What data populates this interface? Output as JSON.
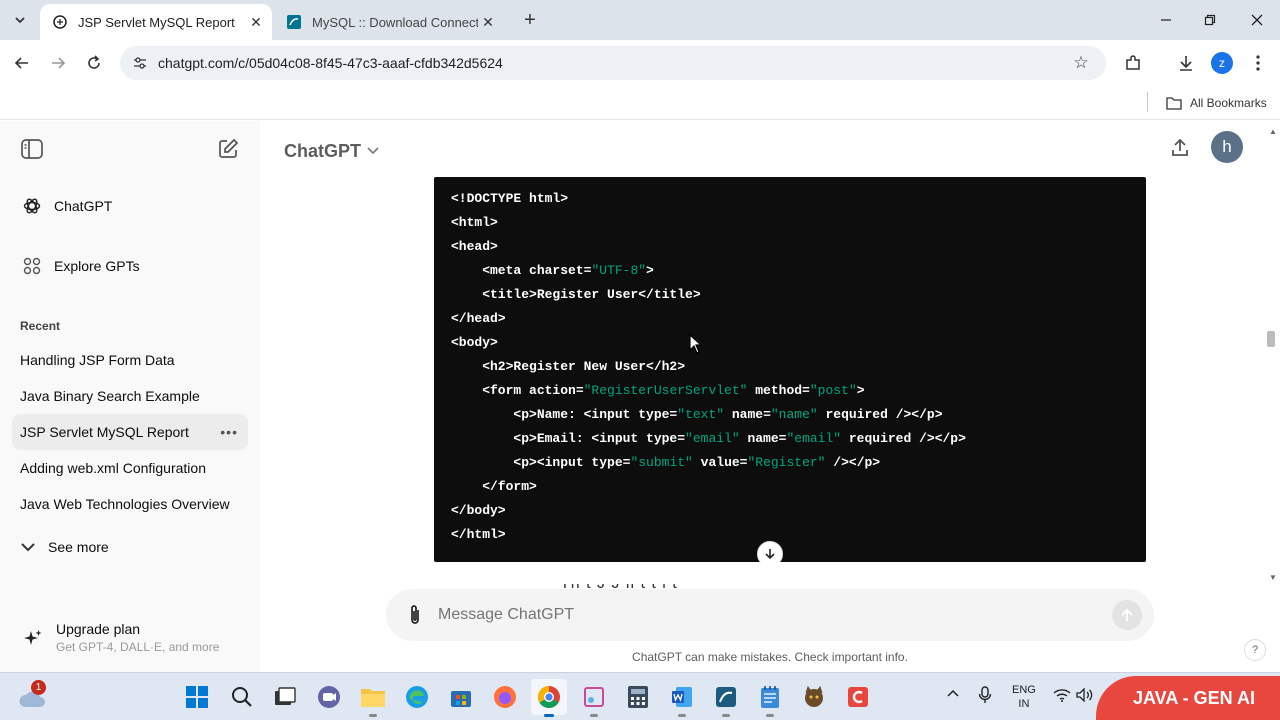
{
  "browser": {
    "tabs": [
      {
        "title": "JSP Servlet MySQL Report",
        "active": true
      },
      {
        "title": "MySQL :: Download Connector/J",
        "active": false
      }
    ],
    "url": "chatgpt.com/c/05d04c08-8f45-47c3-aaaf-cfdb342d5624",
    "profile_initial": "z",
    "bookmarks_label": "All Bookmarks"
  },
  "sidebar": {
    "nav": [
      {
        "label": "ChatGPT",
        "icon": "chatgpt-logo-icon"
      },
      {
        "label": "Explore GPTs",
        "icon": "grid-icon"
      }
    ],
    "recent_label": "Recent",
    "chats": [
      {
        "label": "Handling JSP Form Data",
        "active": false
      },
      {
        "label": "Java Binary Search Example",
        "active": false
      },
      {
        "label": "JSP Servlet MySQL Report",
        "active": true
      },
      {
        "label": "Adding web.xml Configuration",
        "active": false
      },
      {
        "label": "Java Web Technologies Overview",
        "active": false
      }
    ],
    "see_more": "See more",
    "upgrade": {
      "title": "Upgrade plan",
      "subtitle": "Get GPT-4, DALL·E, and more"
    }
  },
  "main": {
    "model": "ChatGPT",
    "user_initial": "h",
    "code_lines": [
      [
        {
          "t": "<!DOCTYPE html>",
          "s": false
        }
      ],
      [
        {
          "t": "<html>",
          "s": false
        }
      ],
      [
        {
          "t": "<head>",
          "s": false
        }
      ],
      [
        {
          "t": "    <meta charset=",
          "s": false
        },
        {
          "t": "\"UTF-8\"",
          "s": true
        },
        {
          "t": ">",
          "s": false
        }
      ],
      [
        {
          "t": "    <title>Register User</title>",
          "s": false
        }
      ],
      [
        {
          "t": "</head>",
          "s": false
        }
      ],
      [
        {
          "t": "<body>",
          "s": false
        }
      ],
      [
        {
          "t": "    <h2>Register New User</h2>",
          "s": false
        }
      ],
      [
        {
          "t": "    <form action=",
          "s": false
        },
        {
          "t": "\"RegisterUserServlet\"",
          "s": true
        },
        {
          "t": " method=",
          "s": false
        },
        {
          "t": "\"post\"",
          "s": true
        },
        {
          "t": ">",
          "s": false
        }
      ],
      [
        {
          "t": "        <p>Name: <input type=",
          "s": false
        },
        {
          "t": "\"text\"",
          "s": true
        },
        {
          "t": " name=",
          "s": false
        },
        {
          "t": "\"name\"",
          "s": true
        },
        {
          "t": " required /></p>",
          "s": false
        }
      ],
      [
        {
          "t": "        <p>Email: <input type=",
          "s": false
        },
        {
          "t": "\"email\"",
          "s": true
        },
        {
          "t": " name=",
          "s": false
        },
        {
          "t": "\"email\"",
          "s": true
        },
        {
          "t": " required /></p>",
          "s": false
        }
      ],
      [
        {
          "t": "        <p><input type=",
          "s": false
        },
        {
          "t": "\"submit\"",
          "s": true
        },
        {
          "t": " value=",
          "s": false
        },
        {
          "t": "\"Register\"",
          "s": true
        },
        {
          "t": " /></p>",
          "s": false
        }
      ],
      [
        {
          "t": "    </form>",
          "s": false
        }
      ],
      [
        {
          "t": "</body>",
          "s": false
        }
      ],
      [
        {
          "t": "</html>",
          "s": false
        }
      ]
    ],
    "partial_text": "Th    t    J    J     ll    t       t    l  t",
    "composer_placeholder": "Message ChatGPT",
    "disclaimer": "ChatGPT can make mistakes. Check important info.",
    "help": "?"
  },
  "taskbar": {
    "notification_count": "1",
    "lang_line1": "ENG",
    "lang_line2": "IN",
    "watermark": "JAVA - GEN AI"
  },
  "colors": {
    "code_bg": "#0d0d0d",
    "code_string": "#00a67d",
    "sidebar_bg": "#f9f9f9",
    "tabstrip_bg": "#dde3ea",
    "watermark_bg": "#e8473f",
    "avatar_bg": "#5a7188"
  }
}
